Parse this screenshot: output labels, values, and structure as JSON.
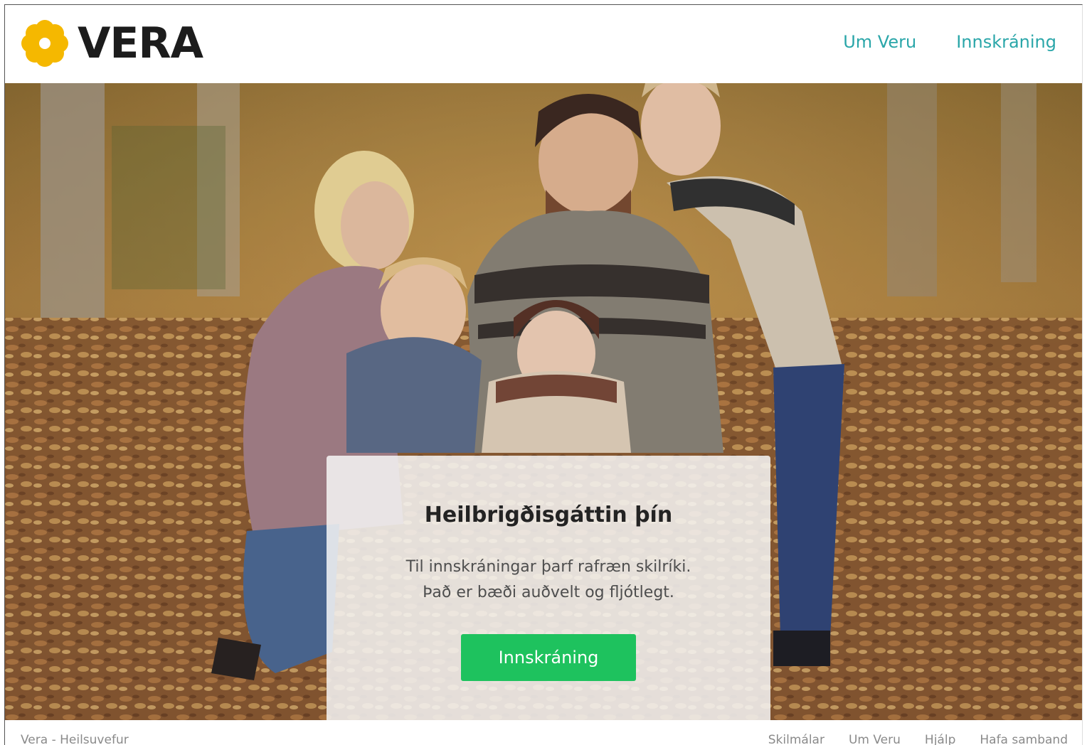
{
  "header": {
    "brand": "VERA",
    "nav": [
      "Um Veru",
      "Innskráning"
    ]
  },
  "hero": {
    "image": "family-autumn-photo"
  },
  "card": {
    "title": "Heilbrigðisgáttin þín",
    "text_line1": "Til innskráningar þarf rafræn skilríki.",
    "text_line2": "Það er bæði auðvelt og fljótlegt.",
    "button": "Innskráning"
  },
  "footer": {
    "left": "Vera - Heilsuvefur",
    "links": [
      "Skilmálar",
      "Um Veru",
      "Hjálp",
      "Hafa samband"
    ]
  },
  "colors": {
    "brand_yellow": "#f5b800",
    "nav_teal": "#2aa6a9",
    "button_green": "#1ec25e"
  }
}
